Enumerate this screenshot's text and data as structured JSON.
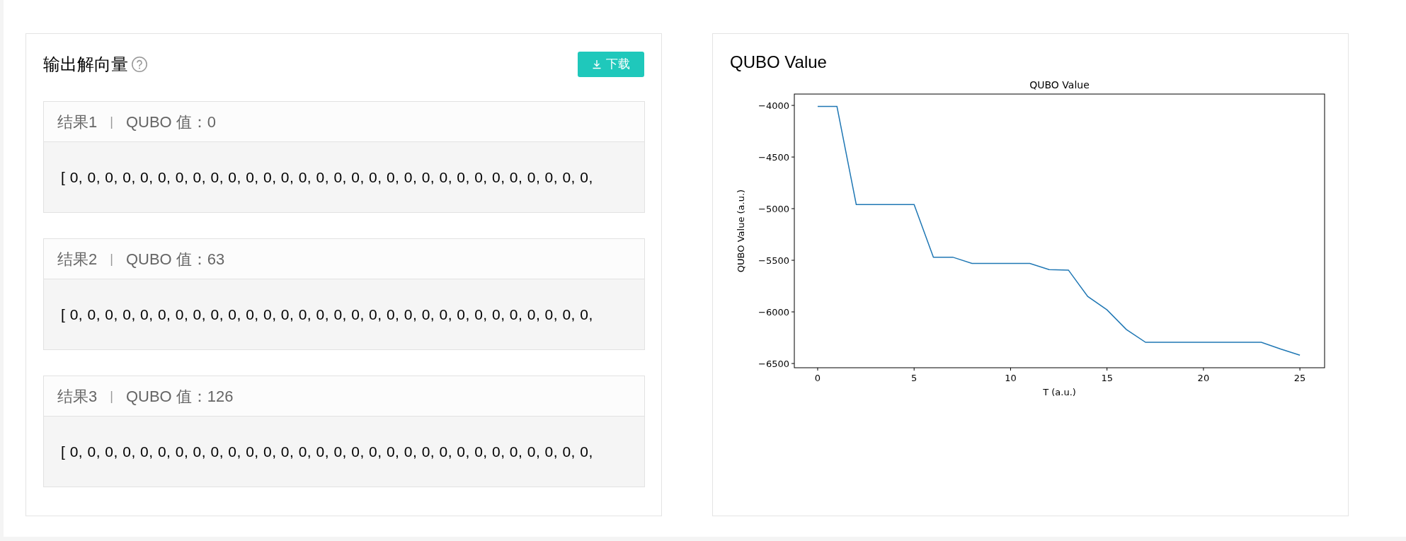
{
  "solution_panel": {
    "title": "输出解向量",
    "download_button": "下载",
    "results": [
      {
        "label": "结果1",
        "separator": "|",
        "qubo": "QUBO 值：0",
        "vector": "[ 0, 0, 0, 0, 0, 0, 0, 0, 0, 0, 0, 0, 0, 0, 0, 0, 0, 0, 0, 0, 0, 0, 0, 0, 0, 0, 0, 0, 0, 0,"
      },
      {
        "label": "结果2",
        "separator": "|",
        "qubo": "QUBO 值：63",
        "vector": "[ 0, 0, 0, 0, 0, 0, 0, 0, 0, 0, 0, 0, 0, 0, 0, 0, 0, 0, 0, 0, 0, 0, 0, 0, 0, 0, 0, 0, 0, 0,"
      },
      {
        "label": "结果3",
        "separator": "|",
        "qubo": "QUBO 值：126",
        "vector": "[ 0, 0, 0, 0, 0, 0, 0, 0, 0, 0, 0, 0, 0, 0, 0, 0, 0, 0, 0, 0, 0, 0, 0, 0, 0, 0, 0, 0, 0, 0,"
      }
    ]
  },
  "chart_panel": {
    "title": "QUBO Value",
    "chart_data": {
      "type": "line",
      "title": "QUBO Value",
      "xlabel": "T (a.u.)",
      "ylabel": "QUBO Value (a.u.)",
      "x": [
        0,
        1,
        2,
        3,
        4,
        5,
        6,
        7,
        8,
        9,
        10,
        11,
        12,
        13,
        14,
        15,
        16,
        17,
        18,
        19,
        20,
        21,
        22,
        23,
        24,
        25
      ],
      "series": [
        {
          "color": "#1f77b4",
          "values": [
            -4010,
            -4010,
            -4960,
            -4960,
            -4960,
            -4960,
            -5470,
            -5470,
            -5530,
            -5530,
            -5530,
            -5530,
            -5590,
            -5595,
            -5850,
            -5980,
            -6170,
            -6295,
            -6295,
            -6295,
            -6295,
            -6295,
            -6295,
            -6295,
            -6360,
            -6420
          ]
        }
      ],
      "xlim": [
        -1.21,
        26.28
      ],
      "ylim": [
        -6541,
        -3890
      ],
      "xticks": [
        0,
        5,
        10,
        15,
        20,
        25
      ],
      "yticks": [
        {
          "value": -4000,
          "label": "−4000"
        },
        {
          "value": -4500,
          "label": "−4500"
        },
        {
          "value": -5000,
          "label": "−5000"
        },
        {
          "value": -5500,
          "label": "−5500"
        },
        {
          "value": -6000,
          "label": "−6000"
        },
        {
          "value": -6500,
          "label": "−6500"
        }
      ]
    }
  }
}
